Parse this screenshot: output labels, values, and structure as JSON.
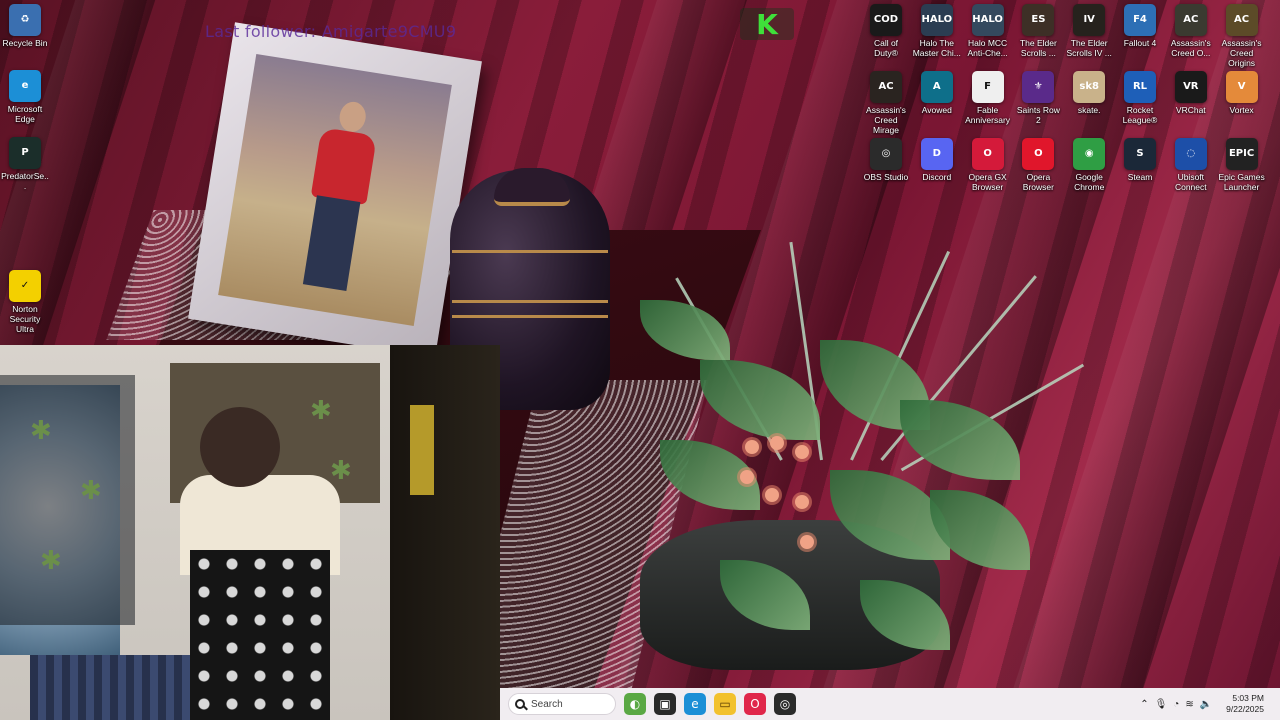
{
  "overlay": {
    "last_follower": "Last follower: Amigarte9CMU9",
    "badge_letter": "K"
  },
  "desktop_left": [
    {
      "name": "recycle-bin-icon",
      "label": "Recycle Bin",
      "color": "#3a6fb0",
      "glyph": "♻"
    },
    {
      "name": "microsoft-edge-icon",
      "label": "Microsoft Edge",
      "color": "#1c8fd6",
      "glyph": "e"
    },
    {
      "name": "predatorsense-icon",
      "label": "PredatorSe...",
      "color": "#1b2e2a",
      "glyph": "P"
    },
    {
      "name": "norton-icon",
      "label": "Norton Security Ultra",
      "color": "#f3d000",
      "glyph": "✓"
    }
  ],
  "desktop_grid": [
    {
      "name": "call-of-duty-icon",
      "label": "Call of Duty®",
      "color": "#1a1a1a",
      "glyph": "COD"
    },
    {
      "name": "halo-mcc-icon",
      "label": "Halo The Master Chi...",
      "color": "#2b3d52",
      "glyph": "HALO"
    },
    {
      "name": "halo-mcc-anticheat-icon",
      "label": "Halo MCC Anti-Che...",
      "color": "#34495e",
      "glyph": "HALO"
    },
    {
      "name": "elder-scrolls-online-icon",
      "label": "The Elder Scrolls ...",
      "color": "#3d2f26",
      "glyph": "ES"
    },
    {
      "name": "elder-scrolls-iv-icon",
      "label": "The Elder Scrolls IV ...",
      "color": "#26221d",
      "glyph": "IV"
    },
    {
      "name": "fallout-4-icon",
      "label": "Fallout 4",
      "color": "#2d6fb5",
      "glyph": "F4"
    },
    {
      "name": "assassins-creed-odyssey-icon",
      "label": "Assassin's Creed O...",
      "color": "#3a3a30",
      "glyph": "AC"
    },
    {
      "name": "assassins-creed-origins-icon",
      "label": "Assassin's Creed Origins",
      "color": "#5c4b28",
      "glyph": "AC"
    },
    {
      "name": "assassins-creed-mirage-icon",
      "label": "Assassin's Creed Mirage",
      "color": "#2a2420",
      "glyph": "AC"
    },
    {
      "name": "avowed-icon",
      "label": "Avowed",
      "color": "#0e6f8a",
      "glyph": "A"
    },
    {
      "name": "fable-anniversary-icon",
      "label": "Fable Anniversary",
      "color": "#efefef",
      "glyph": "F"
    },
    {
      "name": "saints-row-2-icon",
      "label": "Saints Row 2",
      "color": "#5a2a8a",
      "glyph": "⚜"
    },
    {
      "name": "skate-icon",
      "label": "skate.",
      "color": "#c9b28a",
      "glyph": "sk8"
    },
    {
      "name": "rocket-league-icon",
      "label": "Rocket League®",
      "color": "#1e5fb8",
      "glyph": "RL"
    },
    {
      "name": "vrchat-icon",
      "label": "VRChat",
      "color": "#1a1a1a",
      "glyph": "VR"
    },
    {
      "name": "vortex-icon",
      "label": "Vortex",
      "color": "#e48a3a",
      "glyph": "V"
    },
    {
      "name": "obs-studio-icon",
      "label": "OBS Studio",
      "color": "#2b2b2b",
      "glyph": "◎"
    },
    {
      "name": "discord-icon",
      "label": "Discord",
      "color": "#5865f2",
      "glyph": "D"
    },
    {
      "name": "opera-gx-icon",
      "label": "Opera GX Browser",
      "color": "#d41a3a",
      "glyph": "O"
    },
    {
      "name": "opera-browser-icon",
      "label": "Opera Browser",
      "color": "#e0162b",
      "glyph": "O"
    },
    {
      "name": "google-chrome-icon",
      "label": "Google Chrome",
      "color": "#2f9e44",
      "glyph": "◉"
    },
    {
      "name": "steam-icon",
      "label": "Steam",
      "color": "#1b2838",
      "glyph": "S"
    },
    {
      "name": "ubisoft-connect-icon",
      "label": "Ubisoft Connect",
      "color": "#1d4fa8",
      "glyph": "◌"
    },
    {
      "name": "epic-games-icon",
      "label": "Epic Games Launcher",
      "color": "#222222",
      "glyph": "EPIC"
    }
  ],
  "taskbar": {
    "search_placeholder": "Search",
    "apps": [
      {
        "name": "widgets-icon",
        "color": "#5aa844",
        "glyph": "◐"
      },
      {
        "name": "task-view-icon",
        "color": "#2a2a2a",
        "glyph": "▣"
      },
      {
        "name": "edge-taskbar-icon",
        "color": "#1c8fd6",
        "glyph": "e"
      },
      {
        "name": "file-explorer-icon",
        "color": "#f2c12e",
        "glyph": "▭"
      },
      {
        "name": "opera-gx-taskbar-icon",
        "color": "#e0264a",
        "glyph": "O"
      },
      {
        "name": "obs-taskbar-icon",
        "color": "#2b2b2b",
        "glyph": "◎"
      }
    ],
    "time": "5:03 PM",
    "date": "9/22/2025"
  }
}
